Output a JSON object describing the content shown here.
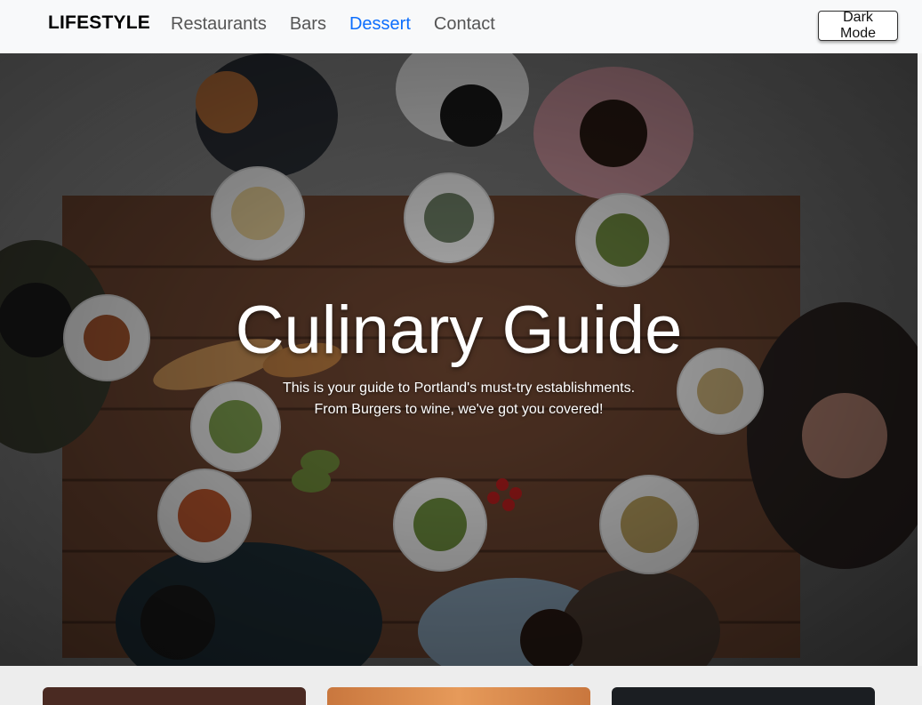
{
  "navbar": {
    "brand": "LIFESTYLE",
    "links": [
      {
        "label": "Restaurants",
        "active": false
      },
      {
        "label": "Bars",
        "active": false
      },
      {
        "label": "Dessert",
        "active": true
      },
      {
        "label": "Contact",
        "active": false
      }
    ],
    "dark_mode_label": "Dark Mode"
  },
  "hero": {
    "title": "Culinary Guide",
    "subtitle_line1": "This is your guide to Portland's must-try establishments.",
    "subtitle_line2": "From Burgers to wine, we've got you covered!"
  },
  "colors": {
    "active_link": "#0d6efd",
    "navbar_bg": "#f8f9fa",
    "card_1": "#4a2a22",
    "card_2": "#d8884a",
    "card_3": "#1b1e22"
  }
}
